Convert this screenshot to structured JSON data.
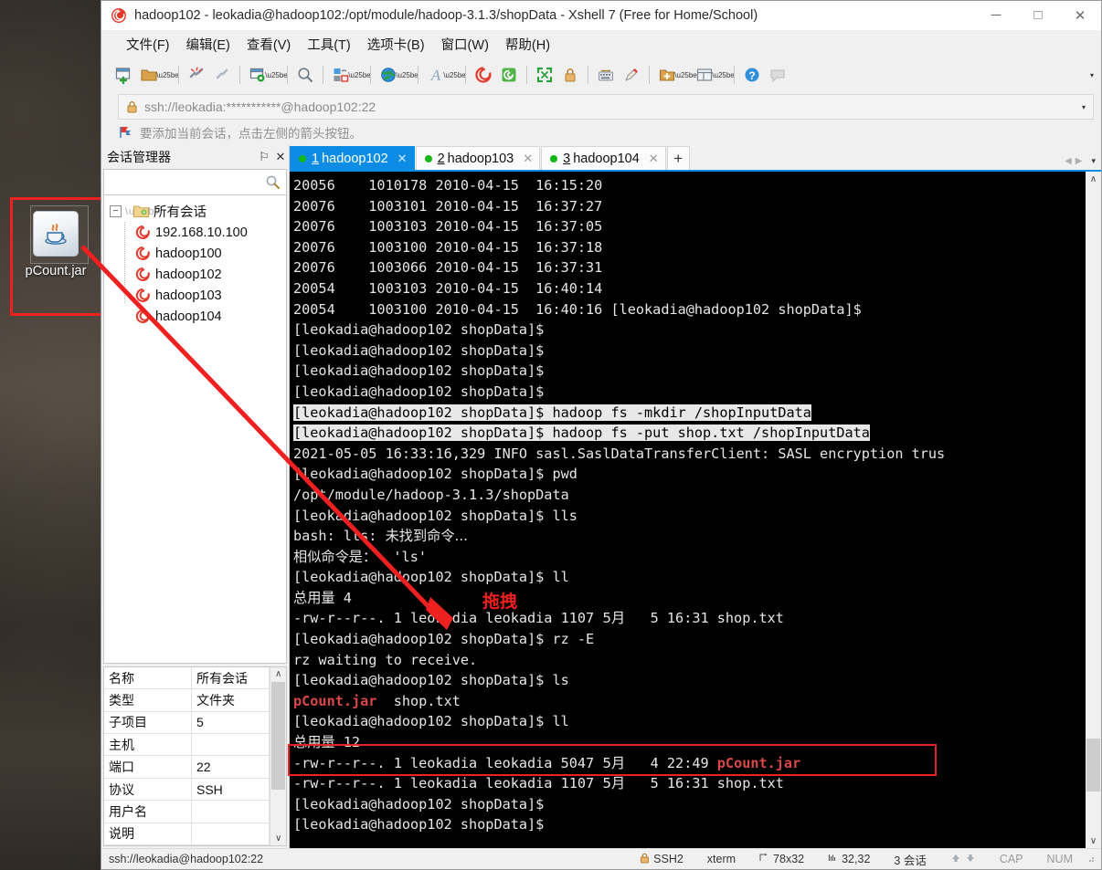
{
  "window": {
    "title": "hadoop102 - leokadia@hadoop102:/opt/module/hadoop-3.1.3/shopData - Xshell 7 (Free for Home/School)",
    "minimize_label": "─",
    "maximize_label": "□",
    "close_label": "✕",
    "app_icon": "xshell-logo-icon"
  },
  "menubar": {
    "items": [
      {
        "label": "文件(F)",
        "name": "menu-file"
      },
      {
        "label": "编辑(E)",
        "name": "menu-edit"
      },
      {
        "label": "查看(V)",
        "name": "menu-view"
      },
      {
        "label": "工具(T)",
        "name": "menu-tools"
      },
      {
        "label": "选项卡(B)",
        "name": "menu-tabs"
      },
      {
        "label": "窗口(W)",
        "name": "menu-window"
      },
      {
        "label": "帮助(H)",
        "name": "menu-help"
      }
    ]
  },
  "toolbar": {
    "overflow_label": "▾",
    "icons": [
      "new-session-icon",
      "open-folder-icon",
      "disconnect-icon",
      "reconnect-icon",
      "session-properties-icon",
      "find-icon",
      "transfer-file-icon",
      "web-icon",
      "font-icon",
      "xshell-icon",
      "xftp-icon",
      "fullscreen-icon",
      "lock-icon",
      "keyboard-icon",
      "highlight-icon",
      "new-folder-icon",
      "layout-icon",
      "help-icon",
      "comment-icon"
    ]
  },
  "address_bar": {
    "lock_icon": "lock-icon",
    "url": "ssh://leokadia:***********@hadoop102:22",
    "dropdown_label": "▾"
  },
  "notice_bar": {
    "icon": "red-flag-icon",
    "text": "要添加当前会话，点击左侧的箭头按钮。"
  },
  "session_panel": {
    "title": "会话管理器",
    "pin_label": "⚐",
    "close_label": "✕",
    "search_icon": "search-icon",
    "tree": {
      "root_label": "所有会话",
      "expander": "−",
      "children": [
        {
          "label": "192.168.10.100",
          "icon": "session-icon"
        },
        {
          "label": "hadoop100",
          "icon": "session-icon"
        },
        {
          "label": "hadoop102",
          "icon": "session-icon"
        },
        {
          "label": "hadoop103",
          "icon": "session-icon"
        },
        {
          "label": "hadoop104",
          "icon": "session-icon"
        }
      ]
    },
    "properties": [
      {
        "key": "名称",
        "value": "所有会话"
      },
      {
        "key": "类型",
        "value": "文件夹"
      },
      {
        "key": "子项目",
        "value": "5"
      },
      {
        "key": "主机",
        "value": ""
      },
      {
        "key": "端口",
        "value": "22"
      },
      {
        "key": "协议",
        "value": "SSH"
      },
      {
        "key": "用户名",
        "value": ""
      },
      {
        "key": "说明",
        "value": ""
      }
    ],
    "scroll_up": "∧",
    "scroll_down": "∨"
  },
  "tabs": {
    "items": [
      {
        "num": "1",
        "label": "hadoop102",
        "active": true,
        "close": "✕",
        "dot_color": "#14b814"
      },
      {
        "num": "2",
        "label": "hadoop103",
        "active": false,
        "close": "✕",
        "dot_color": "#14b814"
      },
      {
        "num": "3",
        "label": "hadoop104",
        "active": false,
        "close": "✕",
        "dot_color": "#14b814"
      }
    ],
    "add_label": "+",
    "nav_prev": "◀",
    "nav_next": "▶",
    "nav_menu": "▾"
  },
  "terminal": {
    "lines": [
      {
        "segments": [
          {
            "t": "20056    1010178 2010-04-15  16:15:20"
          }
        ]
      },
      {
        "segments": [
          {
            "t": "20076    1003101 2010-04-15  16:37:27"
          }
        ]
      },
      {
        "segments": [
          {
            "t": "20076    1003103 2010-04-15  16:37:05"
          }
        ]
      },
      {
        "segments": [
          {
            "t": "20076    1003100 2010-04-15  16:37:18"
          }
        ]
      },
      {
        "segments": [
          {
            "t": "20076    1003066 2010-04-15  16:37:31"
          }
        ]
      },
      {
        "segments": [
          {
            "t": "20054    1003103 2010-04-15  16:40:14"
          }
        ]
      },
      {
        "segments": [
          {
            "t": "20054    1003100 2010-04-15  16:40:16 [leokadia@hadoop102 shopData]$ "
          }
        ]
      },
      {
        "segments": [
          {
            "t": "[leokadia@hadoop102 shopData]$ "
          }
        ]
      },
      {
        "segments": [
          {
            "t": "[leokadia@hadoop102 shopData]$ "
          }
        ]
      },
      {
        "segments": [
          {
            "t": "[leokadia@hadoop102 shopData]$ "
          }
        ]
      },
      {
        "segments": [
          {
            "t": "[leokadia@hadoop102 shopData]$ "
          }
        ]
      },
      {
        "segments": [
          {
            "t": "[leokadia@hadoop102 shopData]$ hadoop fs -mkdir /shopInputData",
            "c": "sel"
          }
        ]
      },
      {
        "segments": [
          {
            "t": "[leokadia@hadoop102 shopData]$ hadoop fs -put shop.txt /shopInputData",
            "c": "sel"
          }
        ]
      },
      {
        "segments": [
          {
            "t": "2021-05-05 16:33:16,329 INFO sasl.SaslDataTransferClient: SASL encryption trus"
          }
        ]
      },
      {
        "segments": [
          {
            "t": "[leokadia@hadoop102 shopData]$ pwd"
          }
        ]
      },
      {
        "segments": [
          {
            "t": "/opt/module/hadoop-3.1.3/shopData"
          }
        ]
      },
      {
        "segments": [
          {
            "t": "[leokadia@hadoop102 shopData]$ lls"
          }
        ]
      },
      {
        "segments": [
          {
            "t": "bash: lls: ",
            "c": ""
          },
          {
            "t": "未找到命令...",
            "c": "cn"
          }
        ]
      },
      {
        "segments": [
          {
            "t": "相似命令是：",
            "c": "cn"
          },
          {
            "t": "  'ls'"
          }
        ]
      },
      {
        "segments": [
          {
            "t": "[leokadia@hadoop102 shopData]$ ll"
          }
        ]
      },
      {
        "segments": [
          {
            "t": "总用量",
            "c": "cn"
          },
          {
            "t": " 4"
          }
        ]
      },
      {
        "segments": [
          {
            "t": "-rw-r--r--. 1 leokadia leokadia 1107 "
          },
          {
            "t": "5月",
            "c": "cn"
          },
          {
            "t": "   5 16:31 shop.txt"
          }
        ]
      },
      {
        "segments": [
          {
            "t": "[leokadia@hadoop102 shopData]$ rz -E"
          }
        ]
      },
      {
        "segments": [
          {
            "t": "rz waiting to receive."
          }
        ]
      },
      {
        "segments": [
          {
            "t": "[leokadia@hadoop102 shopData]$ ls"
          }
        ]
      },
      {
        "segments": [
          {
            "t": "pCount.jar",
            "c": "red"
          },
          {
            "t": "  shop.txt"
          }
        ]
      },
      {
        "segments": [
          {
            "t": "[leokadia@hadoop102 shopData]$ ll"
          }
        ]
      },
      {
        "segments": [
          {
            "t": "总用量",
            "c": "cn"
          },
          {
            "t": " 12"
          }
        ]
      },
      {
        "segments": [
          {
            "t": "-rw-r--r--. 1 leokadia leokadia 5047 "
          },
          {
            "t": "5月",
            "c": "cn"
          },
          {
            "t": "   4 22:49 "
          },
          {
            "t": "pCount.jar",
            "c": "red"
          }
        ]
      },
      {
        "segments": [
          {
            "t": "-rw-r--r--. 1 leokadia leokadia 1107 "
          },
          {
            "t": "5月",
            "c": "cn"
          },
          {
            "t": "   5 16:31 shop.txt"
          }
        ]
      },
      {
        "segments": [
          {
            "t": "[leokadia@hadoop102 shopData]$ "
          }
        ]
      },
      {
        "segments": [
          {
            "t": "[leokadia@hadoop102 shopData]$ "
          }
        ]
      }
    ],
    "scroll_up": "∧",
    "scroll_down": "∨"
  },
  "annotations": {
    "drag_label": "拖拽",
    "highlight_color": "#ee2020"
  },
  "desktop": {
    "icon_label": "pCount.jar",
    "icon_name": "java-jar-icon"
  },
  "statusbar": {
    "connection": "ssh://leokadia@hadoop102:22",
    "protocol": "SSH2",
    "terminal_type": "xterm",
    "size": "78x32",
    "cursor": "32,32",
    "sessions": "3 会话",
    "cap": "CAP",
    "num": "NUM",
    "lock_icon": "lock-icon",
    "size_icon": "resize-icon",
    "cursor_icon": "cursor-icon",
    "up_icon": "arrow-up-icon",
    "down_icon": "arrow-down-icon"
  }
}
